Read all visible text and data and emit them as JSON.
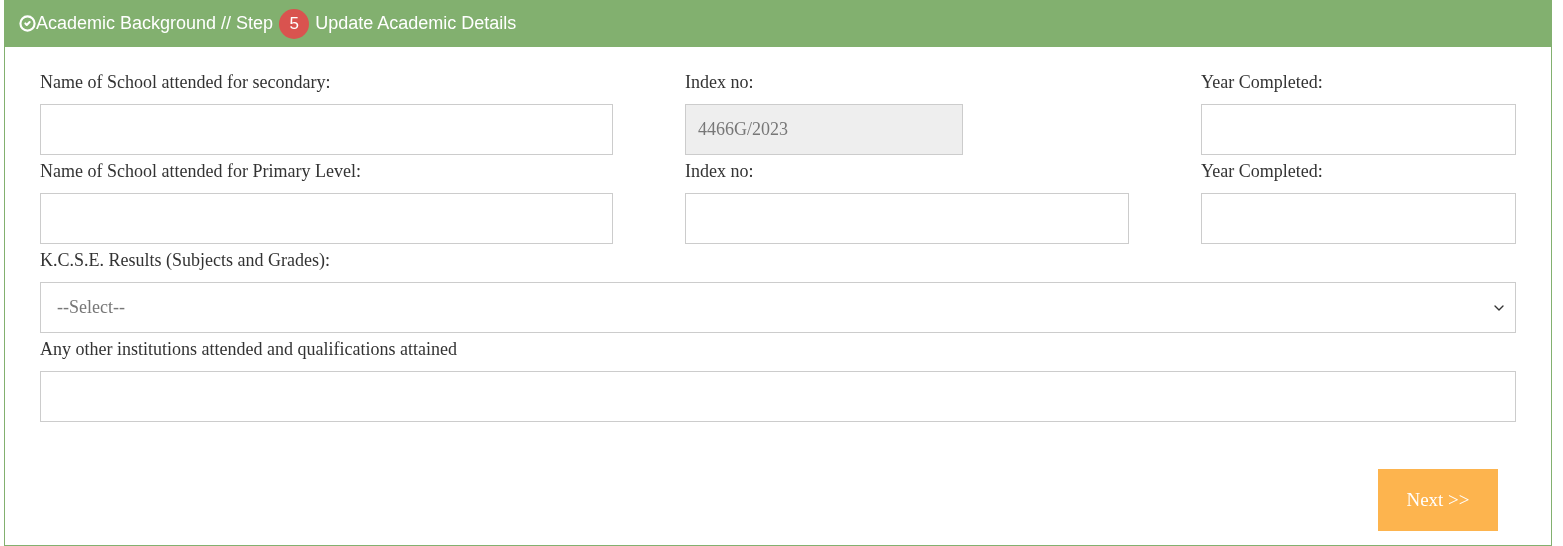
{
  "header": {
    "title": "Academic Background // Step",
    "step": "5",
    "subtitle": "Update Academic Details"
  },
  "rows": [
    {
      "fields": [
        {
          "label": "Name of School attended for secondary:",
          "disabled": false
        },
        {
          "label": "Index no:",
          "value": "4466G/2023",
          "disabled": true
        },
        {
          "label": "Year Completed:",
          "disabled": false
        }
      ]
    },
    {
      "fields": [
        {
          "label": "Name of School attended for Primary Level:",
          "disabled": false
        },
        {
          "label": "Index no:",
          "disabled": false
        },
        {
          "label": "Year Completed:",
          "disabled": false
        }
      ]
    }
  ],
  "results": {
    "label": "K.C.S.E. Results (Subjects and Grades):",
    "placeholder": "--Select--"
  },
  "other": {
    "label": "Any other institutions attended and qualifications attained"
  },
  "next_button": "Next >>"
}
